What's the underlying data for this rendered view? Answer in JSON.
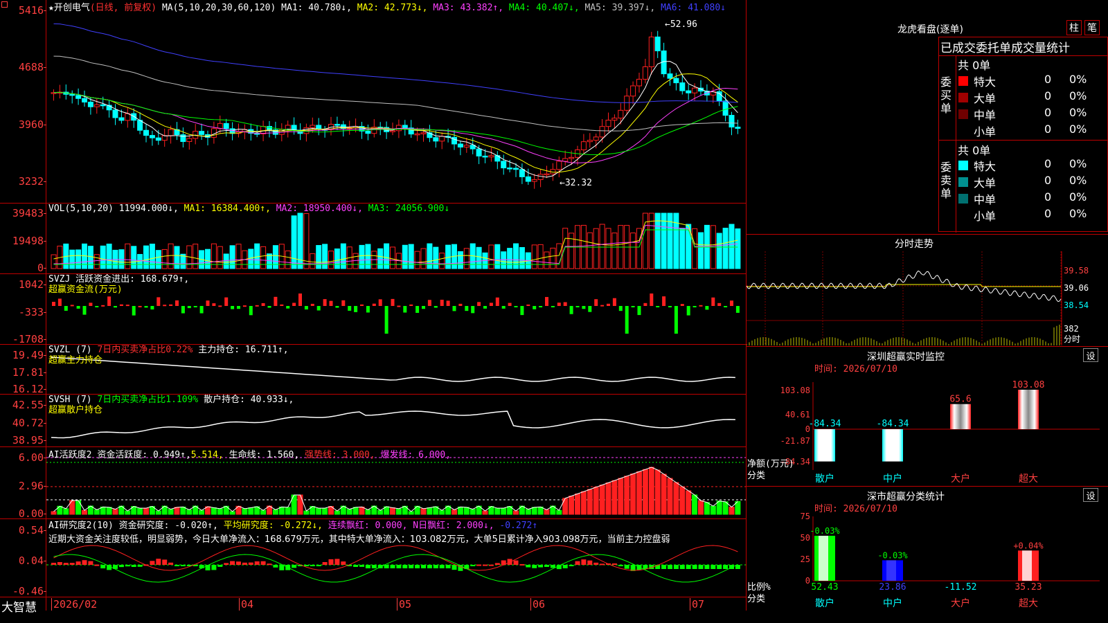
{
  "colors": {
    "up": "#ff2020",
    "down": "#00ffff",
    "axis_red": "#ff4040",
    "green": "#00ff00",
    "yellow": "#ffff00",
    "magenta": "#ff40ff",
    "blue": "#4040ff",
    "white": "#ffffff"
  },
  "main": {
    "title": "★开创电气",
    "mode": "(日线, 前复权)",
    "ma_label": "MA(5,10,20,30,60,120)",
    "ma1": "MA1: 40.780↓,",
    "ma2": "MA2: 42.773↓,",
    "ma3": "MA3: 43.382↑,",
    "ma4": "MA4: 40.407↓,",
    "ma5": "MA5: 39.397↓,",
    "ma6": "MA6: 41.080↓",
    "y_ticks": [
      "5416",
      "4688",
      "3960",
      "3232"
    ],
    "high_label": "52.96",
    "low_label": "32.32"
  },
  "vol": {
    "label": "VOL(5,10,20)",
    "val": "11994.000↓,",
    "ma1": "MA1: 16384.400↑,",
    "ma2": "MA2: 18950.400↓,",
    "ma3": "MA3: 24056.900↓",
    "y_ticks": [
      "39483",
      "19498",
      "0"
    ]
  },
  "svzj": {
    "label": "SVZJ 活跃资金进出: 168.679↑,",
    "sub": "超赢资金流(万元)",
    "y_ticks": [
      "1042",
      "-333",
      "-1708"
    ]
  },
  "svzl": {
    "label": "SVZL (7)",
    "red": "7日内买卖净占比0.22%",
    "rest": "主力持仓: 16.711↑,",
    "sub": "超赢主力持仓",
    "y_ticks": [
      "19.49",
      "17.81",
      "16.12"
    ]
  },
  "svsh": {
    "label": "SVSH (7)",
    "green": "7日内买卖净占比1.109%",
    "rest": "散户持仓: 40.933↓,",
    "sub": "超赢散户持仓",
    "y_ticks": [
      "42.55",
      "40.72",
      "38.95"
    ]
  },
  "ai1": {
    "label": "AI活跃度2",
    "a": "资金活跃度: 0.949↑,",
    "b": "5.514,",
    "c": "生命线: 1.560,",
    "d": "强势线: 3.000,",
    "e": "爆发线: 6.000,",
    "y_ticks": [
      "6.00",
      "2.96",
      "0.00"
    ]
  },
  "ai2": {
    "label": "AI研究度2(10)",
    "a": "资金研究度: -0.020↑,",
    "b": "平均研究度: -0.272↓,",
    "c": "连续飘红: 0.000,",
    "d": "N日飘红: 2.000↓,",
    "e": "-0.272↑",
    "comment": "近期大资金关注度较低，明显弱势，今日大单净流入：168.679万元，其中特大单净流入：103.082万元，大单5日累计净入903.098万元，当前主力控盘弱",
    "y_ticks": [
      "0.54",
      "0.04",
      "-0.46"
    ]
  },
  "xaxis": {
    "logo": "大智慧",
    "labels": [
      "2026/02",
      "04",
      "05",
      "06",
      "07"
    ]
  },
  "right": {
    "lhb_title": "龙虎看盘(逐单)",
    "tab1": "柱",
    "tab2": "笔",
    "table_title": "已成交委托单成交量统计",
    "buy_side": "委买单",
    "sell_side": "委卖单",
    "buy_total": "共 0单",
    "sell_total": "共 0单",
    "buy_rows": [
      {
        "name": "特大",
        "count": "0",
        "pct": "0%",
        "color": "#ff0000"
      },
      {
        "name": "大单",
        "count": "0",
        "pct": "0%",
        "color": "#a00000"
      },
      {
        "name": "中单",
        "count": "0",
        "pct": "0%",
        "color": "#700000"
      },
      {
        "name": "小单",
        "count": "0",
        "pct": "0%",
        "color": ""
      }
    ],
    "sell_rows": [
      {
        "name": "特大",
        "count": "0",
        "pct": "0%",
        "color": "#00ffff"
      },
      {
        "name": "大单",
        "count": "0",
        "pct": "0%",
        "color": "#009090"
      },
      {
        "name": "中单",
        "count": "0",
        "pct": "0%",
        "color": "#007070"
      },
      {
        "name": "小单",
        "count": "0",
        "pct": "0%",
        "color": ""
      }
    ],
    "fenshi_title": "分时走势",
    "fenshi_ticks": [
      "39.58",
      "39.06",
      "38.54"
    ],
    "fenshi_vol": "382",
    "fenshi_unit": "分时",
    "sz_title": "深圳超赢实时监控",
    "sz_btn": "设",
    "sz_time": "时间: 2026/07/10",
    "sz_ticks": [
      "103.08",
      "40.61",
      "0",
      "-21.87",
      "-84.34"
    ],
    "sz_bars": [
      {
        "cat": "散户",
        "value": -84.34,
        "label": "-84.34"
      },
      {
        "cat": "中户",
        "value": -84.34,
        "label": "-84.34"
      },
      {
        "cat": "大户",
        "value": 65.6,
        "label": "65.6"
      },
      {
        "cat": "超大",
        "value": 103.08,
        "label": "103.08"
      }
    ],
    "sz_side1": "净额(万元)",
    "sz_side2": "分类",
    "fl_title": "深市超赢分类统计",
    "fl_btn": "设",
    "fl_time": "时间: 2026/07/10",
    "fl_ticks": [
      "75",
      "50",
      "25",
      "0"
    ],
    "fl_bars": [
      {
        "cat": "散户",
        "value": 52.43,
        "top": "-0.03%",
        "bottom": "52.43"
      },
      {
        "cat": "中户",
        "value": 23.86,
        "top": "-0.03%",
        "bottom": "23.86"
      },
      {
        "cat": "大户",
        "value": -11.52,
        "top": "",
        "bottom": "-11.52"
      },
      {
        "cat": "超大",
        "value": 35.23,
        "top": "+0.04%",
        "bottom": "35.23"
      }
    ],
    "fl_side1": "比例%",
    "fl_side2": "分类"
  }
}
